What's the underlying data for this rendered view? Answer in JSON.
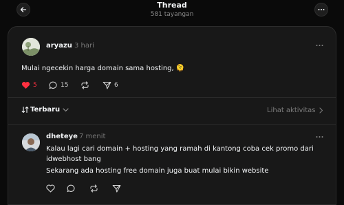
{
  "header": {
    "title": "Thread",
    "subtitle": "581 tayangan",
    "back_icon": "arrow-left-icon",
    "more_icon": "more-horizontal-icon"
  },
  "post": {
    "username": "aryazu",
    "time": "3 hari",
    "text": "Mulai ngecekin harga domain sama hosting, 🫠",
    "likes": "5",
    "comments": "15",
    "shares": "6",
    "liked": true,
    "like_color": "#ff3040"
  },
  "replies_bar": {
    "sort_icon": "sort-arrows-icon",
    "sort_label": "Terbaru",
    "activity_label": "Lihat aktivitas"
  },
  "reply": {
    "username": "dheteye",
    "time": "7 menit",
    "lines": [
      "Kalau lagi cari domain + hosting yang ramah di kantong coba cek promo dari",
      "idwebhost bang",
      "Sekarang ada hosting free domain juga buat mulai bikin website"
    ]
  }
}
